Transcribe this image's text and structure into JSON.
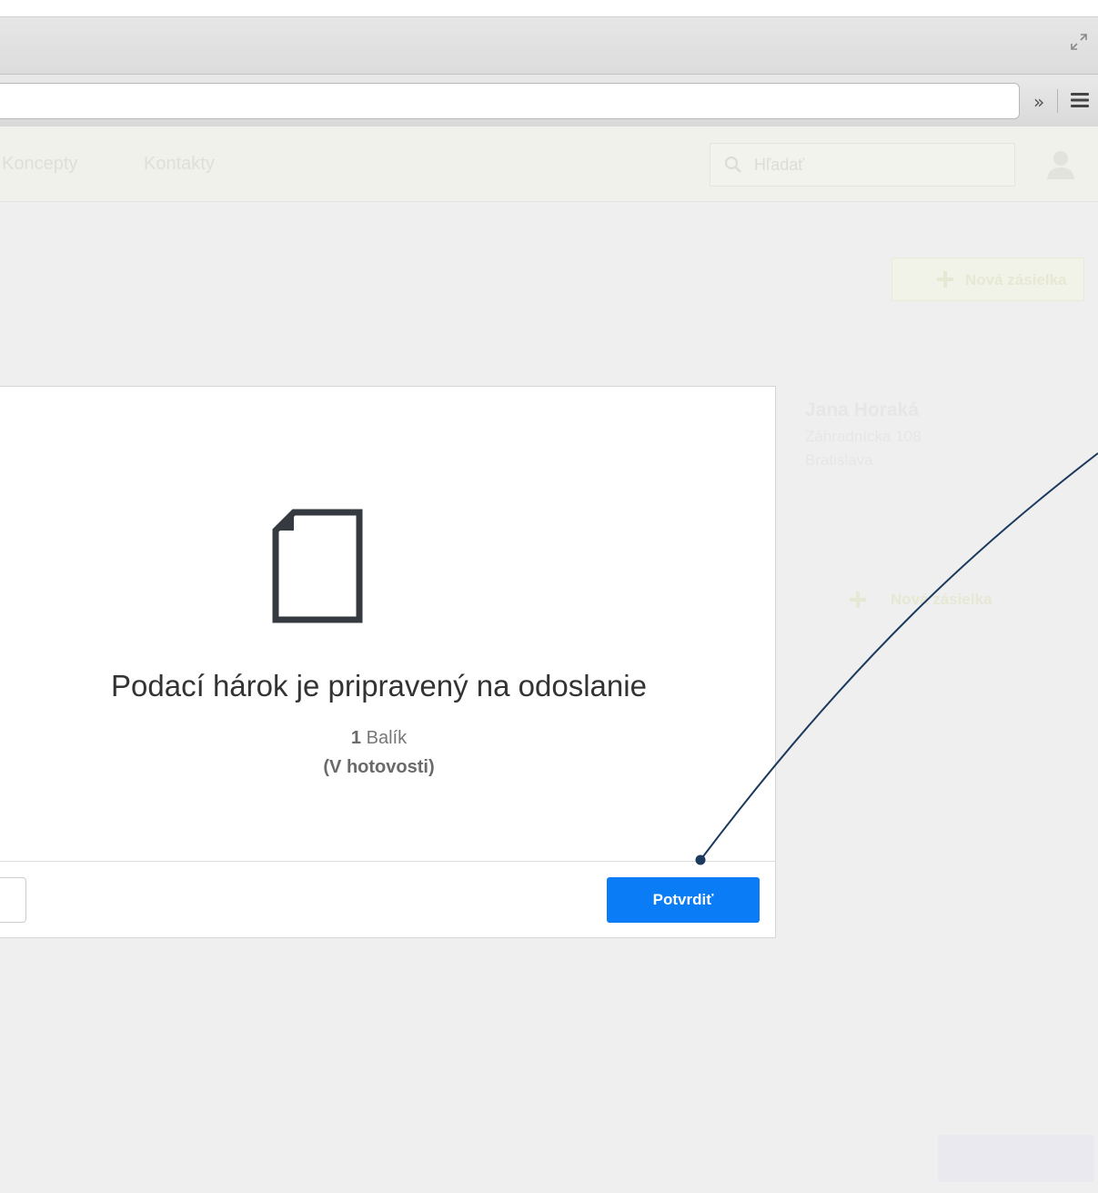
{
  "browser": {
    "icons": [
      "fullscreen-icon",
      "chevron-more-icon",
      "menu-icon"
    ],
    "overflow_label": "»"
  },
  "nav": {
    "links": [
      "Koncepty",
      "Kontakty"
    ],
    "search_placeholder": "Hľadať"
  },
  "actions": {
    "new_shipment_label": "Nová zásielka",
    "new_shipment_label_2": "Nová zásielka",
    "bottom_button_label": ""
  },
  "contact": {
    "name": "Jana Horaká",
    "street": "Záhradnícka 108",
    "city": "Bratislava"
  },
  "dialog": {
    "title": "Podací hárok je pripravený na odoslanie",
    "count_number": "1",
    "count_label": "Balík",
    "payment": "(V hotovosti)",
    "confirm_label": "Potvrdiť"
  },
  "colors": {
    "primary_button": "#0a7cf6",
    "callout": "#1c3a5e"
  }
}
